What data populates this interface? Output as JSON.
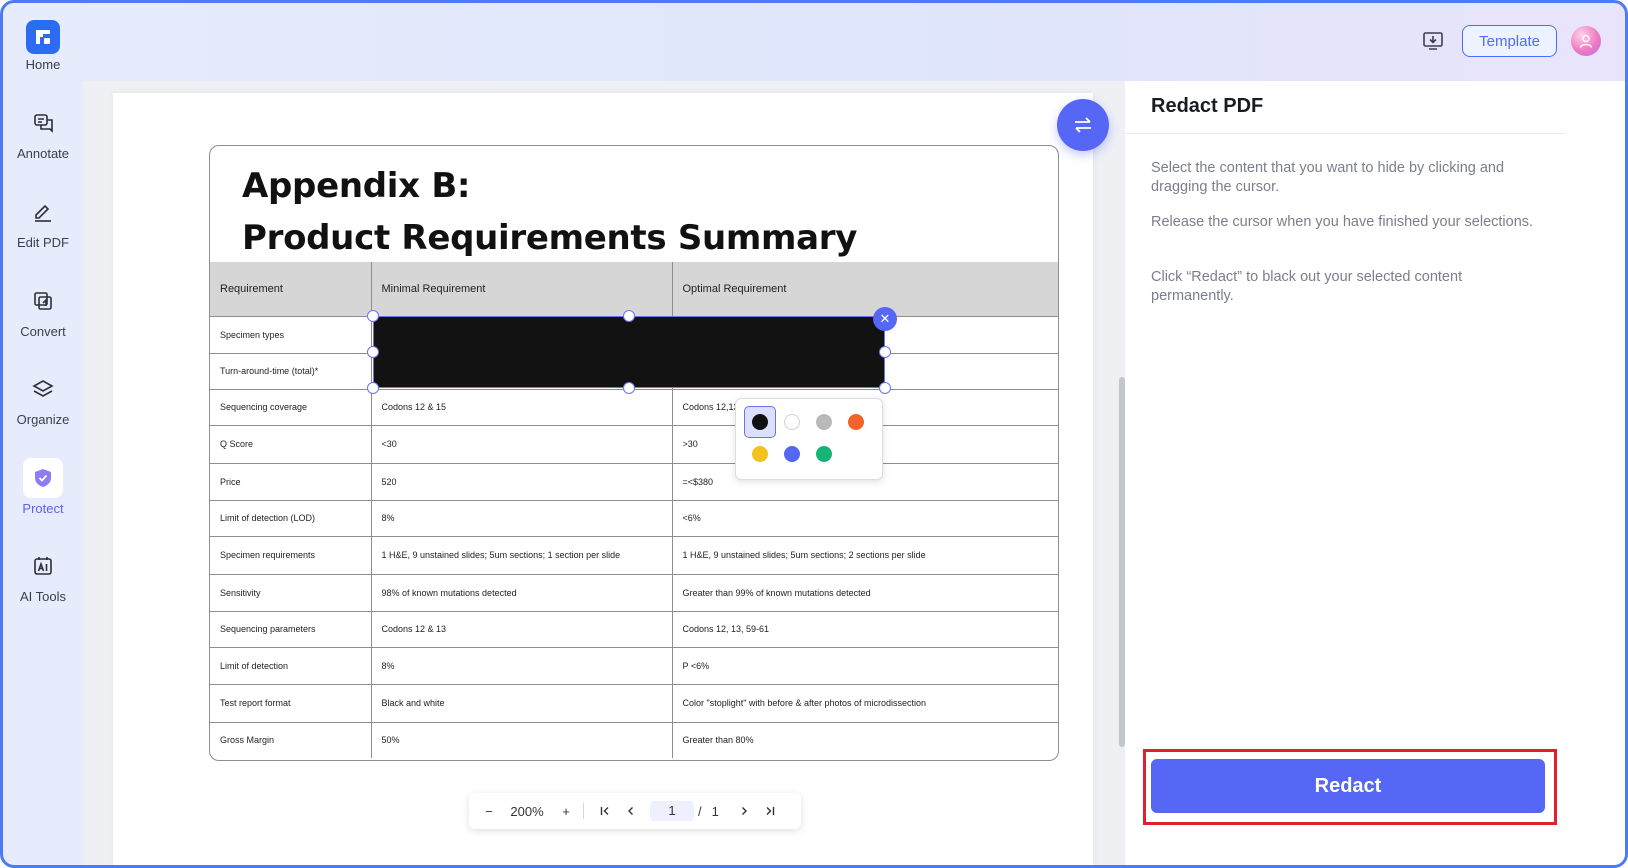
{
  "topbar": {
    "template_label": "Template"
  },
  "sidebar": {
    "items": [
      {
        "label": "Home",
        "icon": "home-logo"
      },
      {
        "label": "Annotate",
        "icon": "annotate-icon"
      },
      {
        "label": "Edit PDF",
        "icon": "edit-pdf-icon"
      },
      {
        "label": "Convert",
        "icon": "convert-icon"
      },
      {
        "label": "Organize",
        "icon": "organize-icon"
      },
      {
        "label": "Protect",
        "icon": "protect-icon",
        "active": true
      },
      {
        "label": "AI Tools",
        "icon": "ai-tools-icon"
      }
    ]
  },
  "document": {
    "title_line1": "Appendix B:",
    "title_line2": "Product Requirements Summary",
    "table": {
      "headers": [
        "Requirement",
        "Minimal Requirement",
        "Optimal Requirement"
      ],
      "rows": [
        [
          "Specimen types",
          "",
          ""
        ],
        [
          "Turn-around-time (total)*",
          "",
          ""
        ],
        [
          "Sequencing coverage",
          "Codons 12 & 15",
          "Codons 12,13"
        ],
        [
          "Q Score",
          "<30",
          ">30"
        ],
        [
          "Price",
          "520",
          "=<$380"
        ],
        [
          "Limit of detection (LOD)",
          "8%",
          "<6%"
        ],
        [
          "Specimen requirements",
          "1 H&E, 9 unstained slides; 5um sections; 1 section per slide",
          "1 H&E, 9 unstained slides; 5um sections; 2 sections per slide"
        ],
        [
          "Sensitivity",
          "98% of known mutations detected",
          "Greater than 99% of known mutations detected"
        ],
        [
          "Sequencing parameters",
          "Codons 12 & 13",
          "Codons 12, 13, 59-61"
        ],
        [
          "Limit of detection",
          "8%",
          "P <6%"
        ],
        [
          "Test report format",
          "Black and white",
          "Color \"stoplight\" with before & after photos of microdissection"
        ],
        [
          "Gross Margin",
          "50%",
          "Greater than 80%"
        ]
      ]
    }
  },
  "redaction": {
    "fill_color": "#121212",
    "colors": [
      "#121212",
      "#ffffff",
      "#b9b9b9",
      "#f2622a",
      "#f4c21f",
      "#5467f3",
      "#16b377"
    ],
    "selected_color": "#121212"
  },
  "zoom_bar": {
    "zoom": "200%",
    "current_page": "1",
    "separator": "/",
    "total_pages": "1"
  },
  "panel": {
    "title": "Redact PDF",
    "instructions": [
      "Select the content that you want to hide by clicking and dragging the cursor.",
      "Release the cursor when you have finished your selections.",
      "Click “Redact” to black out your selected content permanently."
    ],
    "redact_button": "Redact"
  },
  "colors": {
    "accent": "#5667f5",
    "highlight_outline": "#e0202a"
  }
}
